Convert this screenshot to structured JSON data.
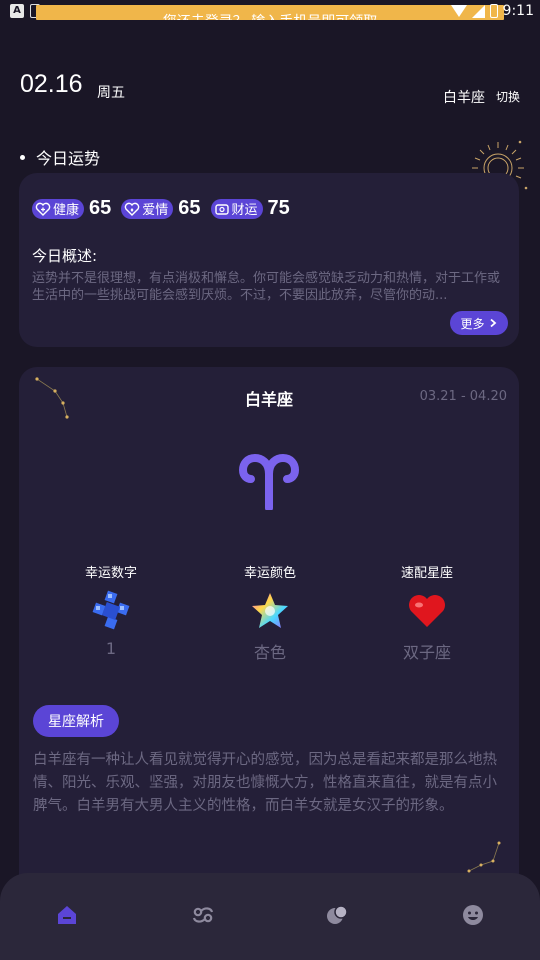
{
  "status_bar": {
    "banner_text": "您还未登录？ 输入手机号即可领取",
    "time": "9:11",
    "icons": [
      "app-a-icon",
      "sim-icon",
      "wifi-icon",
      "signal-icon",
      "battery-icon"
    ]
  },
  "header": {
    "date": "02.16",
    "weekday": "周五",
    "current_sign": "白羊座",
    "switch_label": "切换"
  },
  "today_section": {
    "title": "今日运势"
  },
  "fortune_card": {
    "scores": [
      {
        "label": "健康",
        "value": "65",
        "icon": "health-heart-icon"
      },
      {
        "label": "爱情",
        "value": "65",
        "icon": "love-heart-icon"
      },
      {
        "label": "财运",
        "value": "75",
        "icon": "wallet-icon"
      }
    ],
    "overview_label": "今日概述:",
    "overview_text": "运势并不是很理想，有点消极和懈怠。你可能会感觉缺乏动力和热情，对于工作或生活中的一些挑战可能会感到厌烦。不过，不要因此放弃，尽管你的动...",
    "more_label": "更多"
  },
  "sign_card": {
    "name": "白羊座",
    "date_range": "03.21 - 04.20",
    "symbol_icon": "aries-symbol-icon",
    "lucky": [
      {
        "label": "幸运数字",
        "value": "1",
        "icon": "blue-gem-icon"
      },
      {
        "label": "幸运颜色",
        "value": "杏色",
        "icon": "rainbow-star-icon"
      },
      {
        "label": "速配星座",
        "value": "双子座",
        "icon": "red-heart-icon"
      }
    ],
    "analysis_label": "星座解析",
    "analysis_text": "白羊座有一种让人看见就觉得开心的感觉，因为总是看起来都是那么地热情、阳光、乐观、坚强，对朋友也慷慨大方，性格直来直往，就是有点小脾气。白羊男有大男人主义的性格，而白羊女就是女汉子的形象。"
  },
  "bottom_nav": {
    "items": [
      "home-icon",
      "cancer-zodiac-icon",
      "planet-icon",
      "smiley-icon"
    ],
    "active_color": "#5b45d6",
    "inactive_color": "#8e8a9e"
  },
  "colors": {
    "background": "#1a1626",
    "card": "#241f38",
    "accent": "#5b45d6",
    "muted_text": "#6c6882",
    "banner": "#f0b64a"
  }
}
